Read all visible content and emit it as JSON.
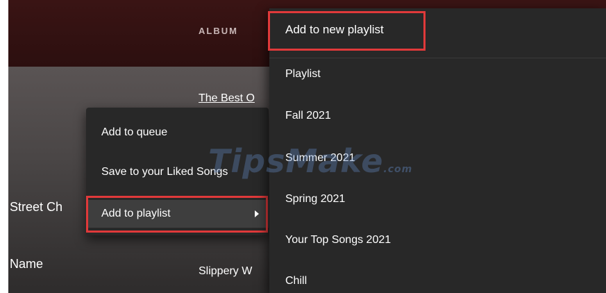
{
  "header": {
    "album_label": "ALBUM"
  },
  "tracks": {
    "title_partial": "The Best O",
    "artist_partial": "Slippery W",
    "left_cut_text": "Street Ch",
    "left_name_text": "Name"
  },
  "context_menu": {
    "items": [
      {
        "label": "Add to queue"
      },
      {
        "label": "Save to your Liked Songs"
      },
      {
        "label": "Add to playlist"
      }
    ]
  },
  "submenu": {
    "new_playlist_label": "Add to new playlist",
    "playlists": [
      {
        "label": "Playlist"
      },
      {
        "label": "Fall 2021"
      },
      {
        "label": "Summer 2021"
      },
      {
        "label": "Spring 2021"
      },
      {
        "label": "Your Top Songs 2021"
      },
      {
        "label": "Chill"
      }
    ]
  },
  "watermark": {
    "text": "TipsMake",
    "suffix": ".com"
  },
  "colors": {
    "highlight": "#e0393a",
    "menu_bg": "#282828",
    "header_bg": "#3a1414"
  }
}
